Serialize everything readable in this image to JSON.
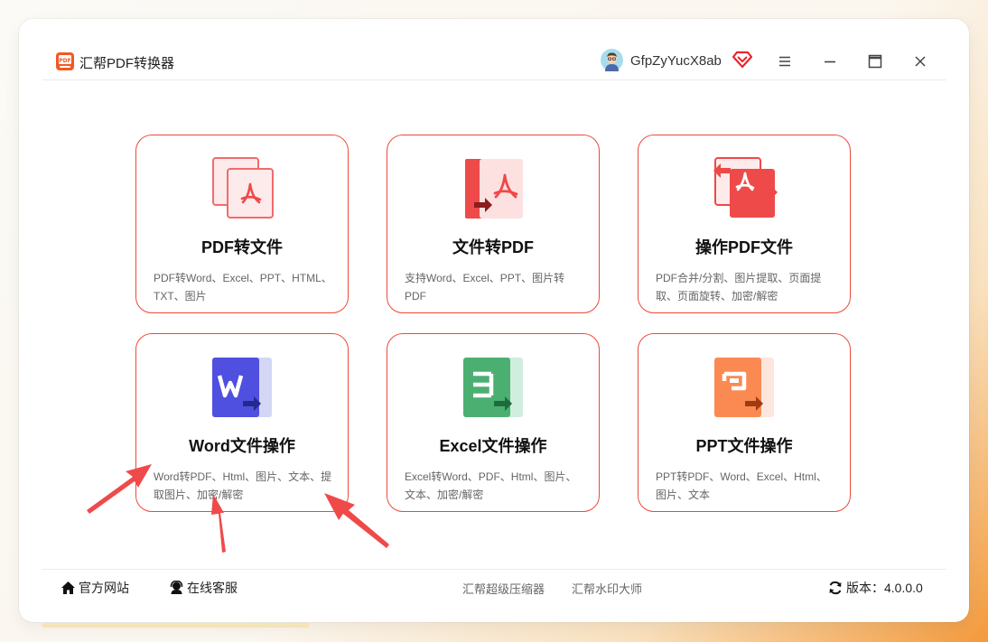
{
  "app": {
    "title": "汇帮PDF转换器",
    "username": "GfpZyYucX8ab"
  },
  "cards": [
    {
      "title": "PDF转文件",
      "desc": "PDF转Word、Excel、PPT、HTML、TXT、图片"
    },
    {
      "title": "文件转PDF",
      "desc": "支持Word、Excel、PPT、图片转PDF"
    },
    {
      "title": "操作PDF文件",
      "desc": "PDF合并/分割、图片提取、页面提取、页面旋转、加密/解密"
    },
    {
      "title": "Word文件操作",
      "desc": "Word转PDF、Html、图片、文本、提取图片、加密/解密"
    },
    {
      "title": "Excel文件操作",
      "desc": "Excel转Word、PDF、Html、图片、文本、加密/解密"
    },
    {
      "title": "PPT文件操作",
      "desc": "PPT转PDF、Word、Excel、Html、图片、文本"
    }
  ],
  "footer": {
    "official_site": "官方网站",
    "online_service": "在线客服",
    "link_compress": "汇帮超级压缩器",
    "link_watermark": "汇帮水印大师",
    "version": "版本：4.0.0.0"
  },
  "colors": {
    "accent_red": "#ec4a3a",
    "word_blue": "#4f4fe0",
    "excel_green": "#4caf72",
    "ppt_orange": "#fb8a52"
  },
  "icons": [
    "pdf-to-file-icon",
    "file-to-pdf-icon",
    "pdf-operate-icon",
    "word-icon",
    "excel-icon",
    "ppt-icon",
    "home-icon",
    "headset-icon",
    "refresh-icon",
    "menu-icon",
    "minimize-icon",
    "maximize-icon",
    "close-icon",
    "vip-diamond-icon"
  ]
}
